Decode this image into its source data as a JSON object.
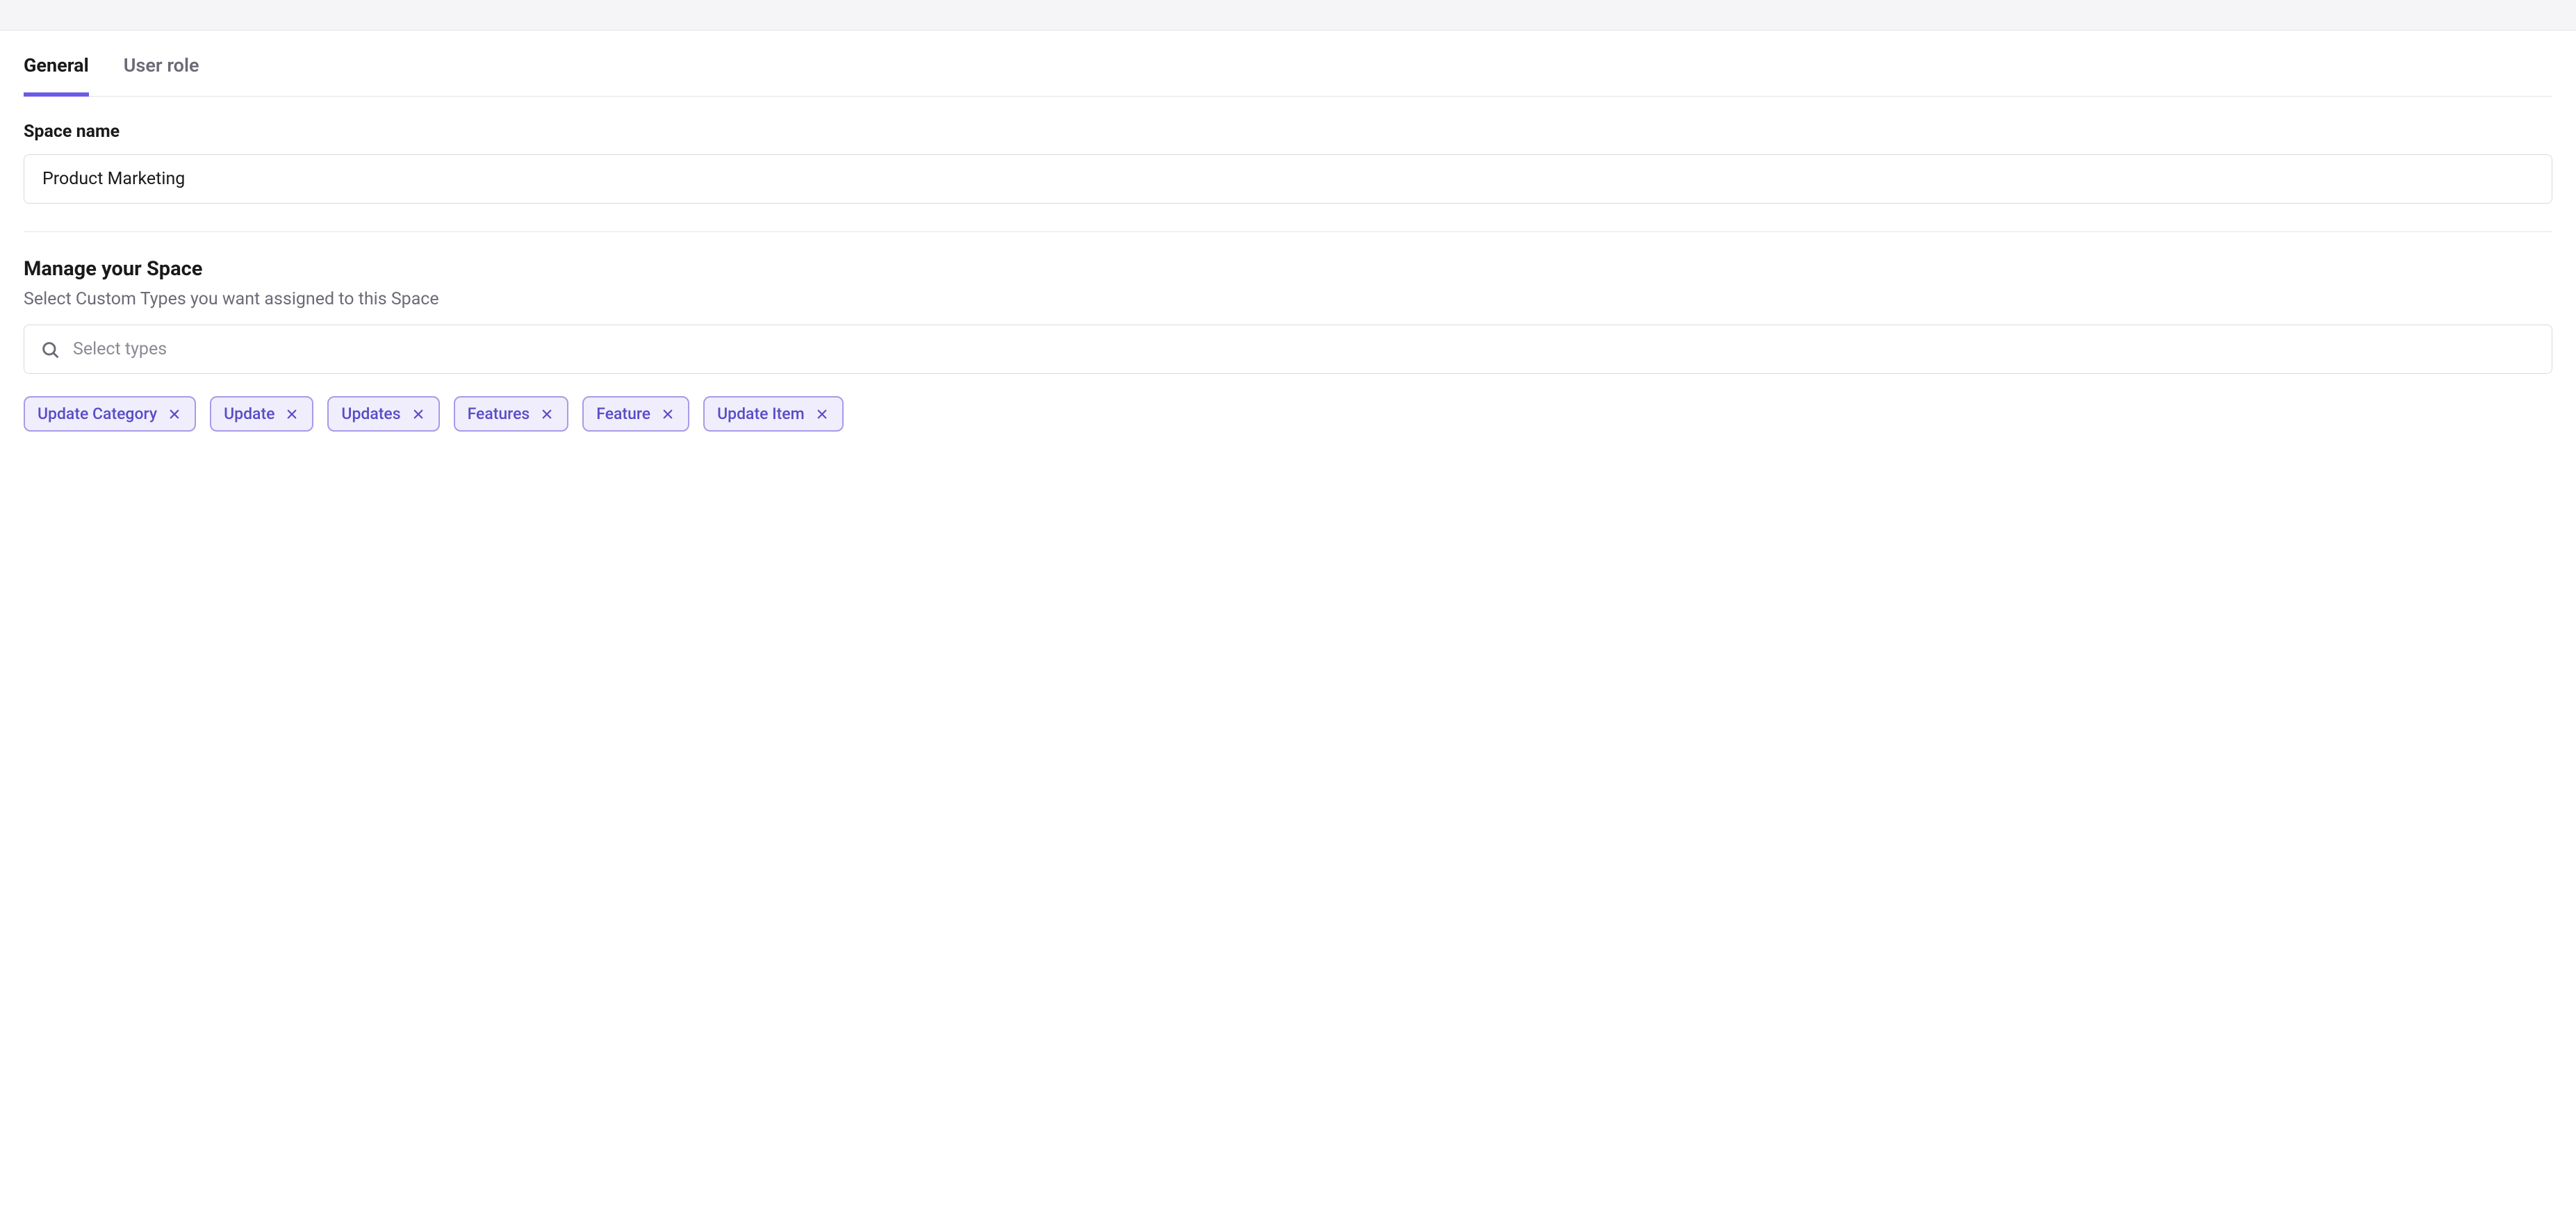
{
  "tabs": [
    {
      "label": "General",
      "active": true
    },
    {
      "label": "User role",
      "active": false
    }
  ],
  "spaceName": {
    "label": "Space name",
    "value": "Product Marketing"
  },
  "manageSpace": {
    "heading": "Manage your Space",
    "subtext": "Select Custom Types you want assigned to this Space",
    "searchPlaceholder": "Select types"
  },
  "selectedTypes": [
    "Update Category",
    "Update",
    "Updates",
    "Features",
    "Feature",
    "Update Item"
  ]
}
